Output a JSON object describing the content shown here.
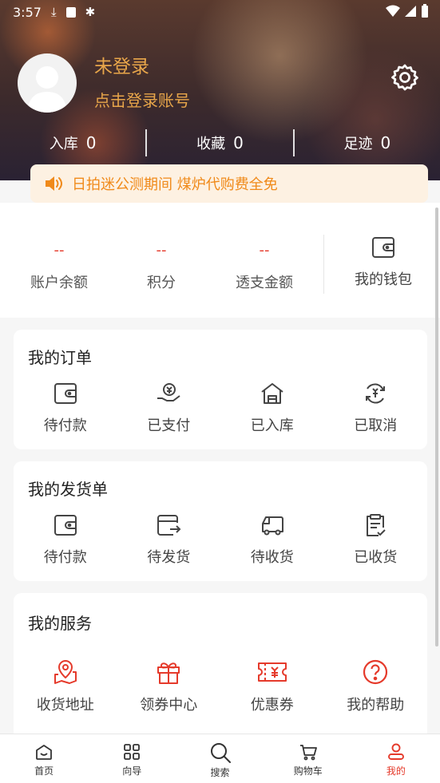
{
  "status_bar": {
    "time": "3:57"
  },
  "profile": {
    "username": "未登录",
    "login_prompt": "点击登录账号"
  },
  "stats": [
    {
      "label": "入库",
      "value": "0"
    },
    {
      "label": "收藏",
      "value": "0"
    },
    {
      "label": "足迹",
      "value": "0"
    }
  ],
  "notice": {
    "text": "日拍迷公测期间 煤炉代购费全免"
  },
  "wallet": {
    "items": [
      {
        "value": "--",
        "label": "账户余额"
      },
      {
        "value": "--",
        "label": "积分"
      },
      {
        "value": "--",
        "label": "透支金额"
      }
    ],
    "my_wallet": "我的钱包"
  },
  "orders": {
    "title": "我的订单",
    "items": [
      {
        "label": "待付款",
        "icon": "wallet-icon"
      },
      {
        "label": "已支付",
        "icon": "paid-hand-icon"
      },
      {
        "label": "已入库",
        "icon": "warehouse-icon"
      },
      {
        "label": "已取消",
        "icon": "refund-cycle-icon"
      }
    ]
  },
  "shipments": {
    "title": "我的发货单",
    "items": [
      {
        "label": "待付款",
        "icon": "wallet-icon"
      },
      {
        "label": "待发货",
        "icon": "ship-out-icon"
      },
      {
        "label": "待收货",
        "icon": "truck-icon"
      },
      {
        "label": "已收货",
        "icon": "clipboard-check-icon"
      }
    ]
  },
  "services": {
    "title": "我的服务",
    "items": [
      {
        "label": "收货地址",
        "icon": "location-map-icon"
      },
      {
        "label": "领券中心",
        "icon": "gift-icon"
      },
      {
        "label": "优惠券",
        "icon": "coupon-icon"
      },
      {
        "label": "我的帮助",
        "icon": "help-icon"
      }
    ]
  },
  "tabs": [
    {
      "label": "首页",
      "icon": "home-icon"
    },
    {
      "label": "向导",
      "icon": "grid-icon"
    },
    {
      "label": "搜索",
      "icon": "search-icon"
    },
    {
      "label": "购物车",
      "icon": "cart-icon"
    },
    {
      "label": "我的",
      "icon": "user-icon",
      "active": true
    }
  ],
  "colors": {
    "accent": "#e53a2b",
    "gold": "#e8a64a",
    "notice_text": "#f08a1a",
    "notice_bg": "#fdf1e2"
  }
}
